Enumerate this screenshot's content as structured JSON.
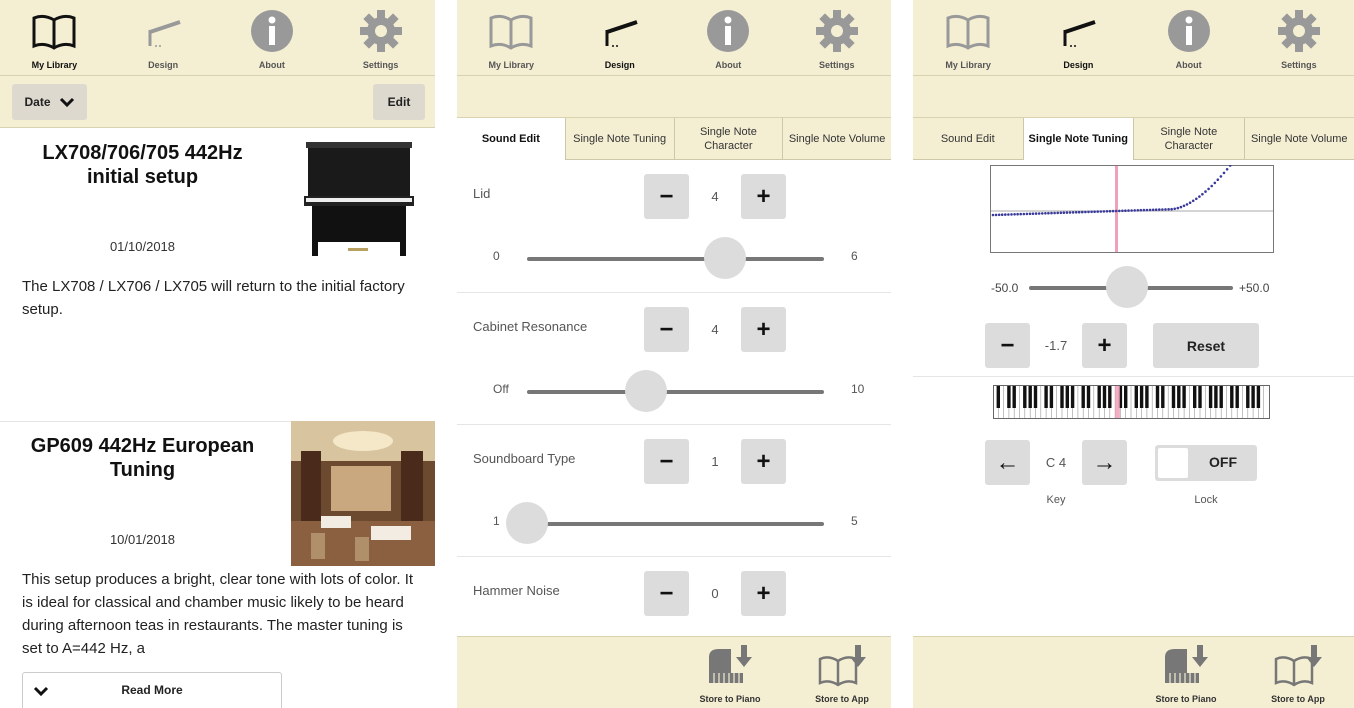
{
  "nav": {
    "library": "My Library",
    "design": "Design",
    "about": "About",
    "settings": "Settings"
  },
  "library": {
    "sort_label": "Date",
    "edit_label": "Edit",
    "cards": [
      {
        "title": "LX708/706/705 442Hz initial setup",
        "date": "01/10/2018",
        "body": "The LX708 / LX706 / LX705 will return to the initial factory setup."
      },
      {
        "title": "GP609 442Hz European Tuning",
        "date": "10/01/2018",
        "body": "This setup produces a bright, clear tone with lots of color. It is ideal for classical and chamber music likely to be heard during afternoon teas in restaurants. The master tuning is set to A=442 Hz, a"
      }
    ],
    "read_more": "Read More"
  },
  "tabs": [
    {
      "label": "Sound Edit"
    },
    {
      "label": "Single Note Tuning"
    },
    {
      "label": "Single Note Character"
    },
    {
      "label": "Single Note Volume"
    }
  ],
  "sound_edit": {
    "minus": "−",
    "plus": "+",
    "params": [
      {
        "label": "Lid",
        "value": "4",
        "min": "0",
        "max": "6",
        "pos": 0.667
      },
      {
        "label": "Cabinet Resonance",
        "value": "4",
        "min": "Off",
        "max": "10",
        "pos": 0.4
      },
      {
        "label": "Soundboard Type",
        "value": "1",
        "min": "1",
        "max": "5",
        "pos": 0.0
      },
      {
        "label": "Hammer Noise",
        "value": "0"
      }
    ]
  },
  "tuning": {
    "min": "-50.0",
    "max": "+50.0",
    "value": "-1.7",
    "slider_pos": 0.48,
    "reset_label": "Reset",
    "key_value": "C 4",
    "key_label": "Key",
    "lock_state": "OFF",
    "lock_label": "Lock",
    "left_arrow": "←",
    "right_arrow": "→"
  },
  "store": {
    "to_piano": "Store to Piano",
    "to_app": "Store to App"
  },
  "colors": {
    "bar_bg": "#f4efd3",
    "button_bg": "#dcdcdc",
    "curve": "#3a3a9a",
    "marker": "#f0a0b8"
  }
}
